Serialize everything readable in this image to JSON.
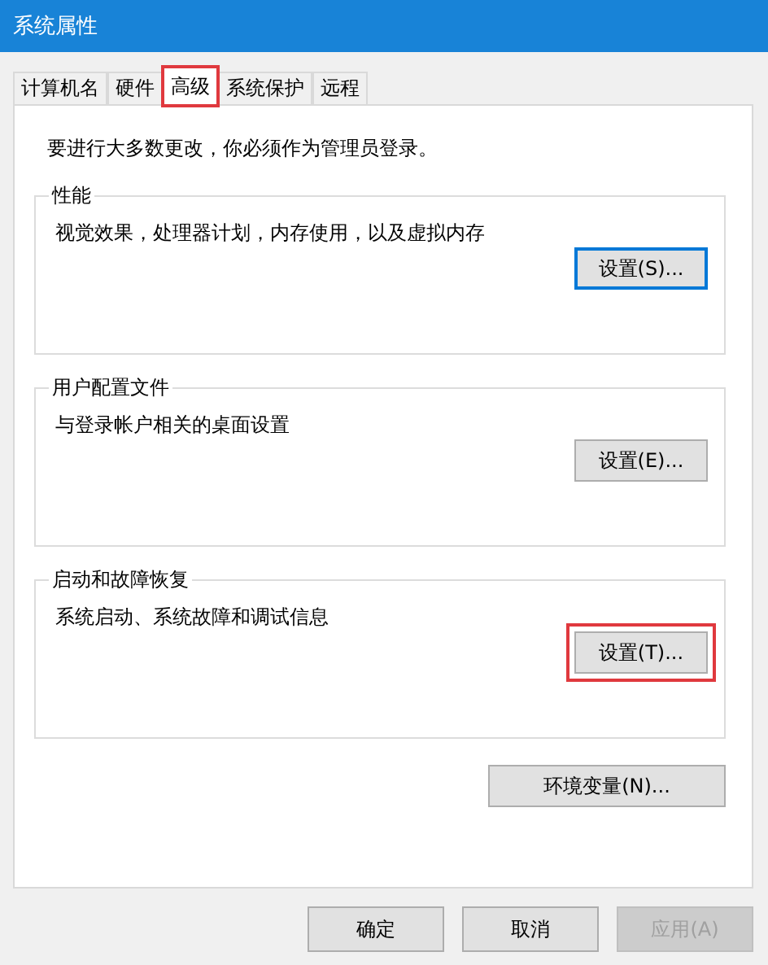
{
  "window": {
    "title": "系统属性"
  },
  "tabs": [
    {
      "label": "计算机名",
      "selected": false,
      "highlighted": false
    },
    {
      "label": "硬件",
      "selected": false,
      "highlighted": false
    },
    {
      "label": "高级",
      "selected": true,
      "highlighted": true
    },
    {
      "label": "系统保护",
      "selected": false,
      "highlighted": false
    },
    {
      "label": "远程",
      "selected": false,
      "highlighted": false
    }
  ],
  "notice": "要进行大多数更改，你必须作为管理员登录。",
  "groups": [
    {
      "title": "性能",
      "description": "视觉效果，处理器计划，内存使用，以及虚拟内存",
      "button": {
        "label": "设置(S)...",
        "focused": true,
        "highlighted": false
      }
    },
    {
      "title": "用户配置文件",
      "description": "与登录帐户相关的桌面设置",
      "button": {
        "label": "设置(E)...",
        "focused": false,
        "highlighted": false
      }
    },
    {
      "title": "启动和故障恢复",
      "description": "系统启动、系统故障和调试信息",
      "button": {
        "label": "设置(T)...",
        "focused": false,
        "highlighted": true
      }
    }
  ],
  "env_button": "环境变量(N)...",
  "buttons": [
    {
      "label": "确定",
      "disabled": false
    },
    {
      "label": "取消",
      "disabled": false
    },
    {
      "label": "应用(A)",
      "disabled": true
    }
  ]
}
